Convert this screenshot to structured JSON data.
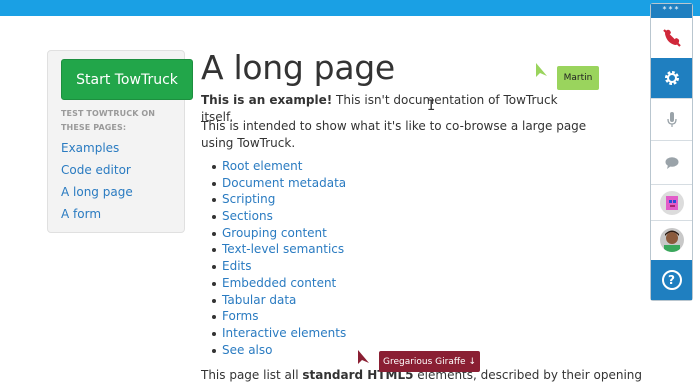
{
  "page": {
    "title": "A long page",
    "intro_bold": "This is an example!",
    "intro_rest": " This isn't documentation of TowTruck itself.",
    "intro_2": "This is intended to show what it's like to co-browse a large page using TowTruck.",
    "toc": [
      "Root element",
      "Document metadata",
      "Scripting",
      "Sections",
      "Grouping content",
      "Text-level semantics",
      "Edits",
      "Embedded content",
      "Tabular data",
      "Forms",
      "Interactive elements",
      "See also"
    ],
    "bottom_pre": "This page list all ",
    "bottom_bold": "standard HTML5",
    "bottom_post": " elements, described by their opening"
  },
  "sidebar": {
    "start_button": "Start TowTruck",
    "heading": "TEST TOWTRUCK ON THESE PAGES:",
    "links": [
      "Examples",
      "Code editor",
      "A long page",
      "A form"
    ]
  },
  "participants": {
    "martin": {
      "name": "Martin",
      "color": "#9ad45d"
    },
    "giraffe": {
      "name": "Gregarious Giraffe ↓",
      "color": "#8a1f33"
    }
  },
  "dock": {
    "grip": "***",
    "help": "?"
  },
  "colors": {
    "topbar": "#1aa0e4",
    "start_button": "#22a64a",
    "link": "#2a7bc1",
    "dock_blue": "#1f7fc0"
  }
}
